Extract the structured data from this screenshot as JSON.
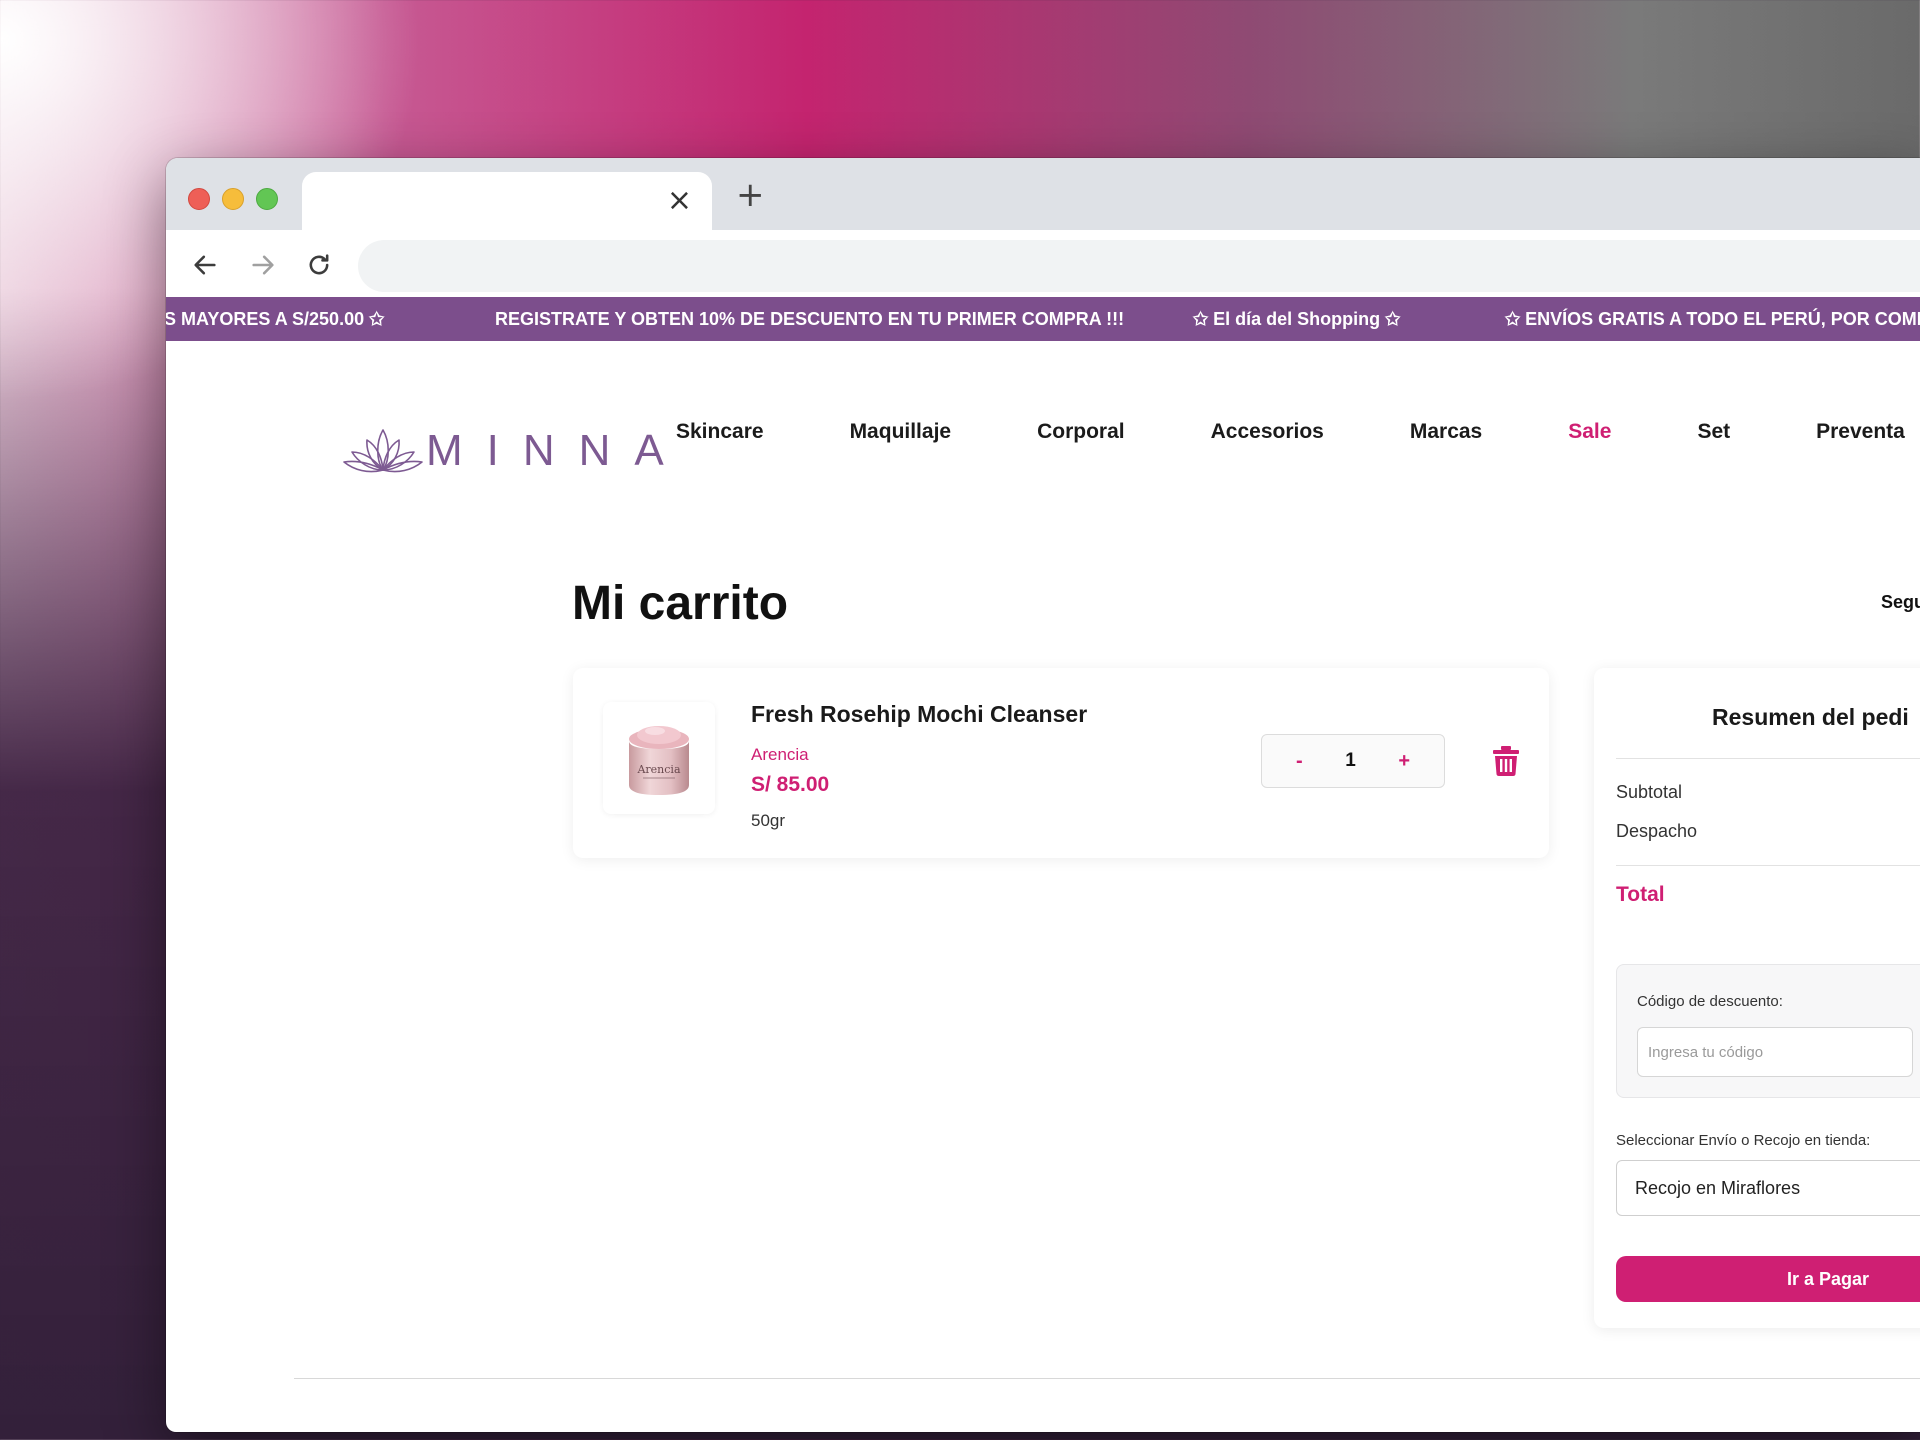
{
  "browser": {
    "tab_close": "×",
    "new_tab": "+"
  },
  "marquee": {
    "items": [
      "S MAYORES A S/250.00 ✩",
      "REGISTRATE Y OBTEN 10% DE DESCUENTO EN TU PRIMER COMPRA !!!",
      "✩ El día del Shopping ✩",
      "✩ ENVÍOS GRATIS A TODO EL PERÚ, POR COMPRA"
    ]
  },
  "header": {
    "logo_text": "MINNA",
    "nav": [
      "Skincare",
      "Maquillaje",
      "Corporal",
      "Accesorios",
      "Marcas",
      "Sale",
      "Set",
      "Preventa"
    ]
  },
  "cart": {
    "title": "Mi carrito",
    "continue_link": "Segu",
    "item": {
      "name": "Fresh Rosehip Mochi Cleanser",
      "brand": "Arencia",
      "price": "S/ 85.00",
      "size": "50gr",
      "quantity": "1",
      "minus": "-",
      "plus": "+",
      "jar_label": "Arencia"
    }
  },
  "summary": {
    "title": "Resumen del pedi",
    "subtotal_label": "Subtotal",
    "shipping_label": "Despacho",
    "total_label": "Total",
    "discount_label": "Código de descuento:",
    "discount_placeholder": "Ingresa tu código",
    "shipping_select_label": "Seleccionar Envío o Recojo en tienda:",
    "shipping_selected": "Recojo en Miraflores",
    "pay_button": "Ir a Pagar"
  },
  "colors": {
    "accent": "#cf1f73",
    "marquee_bg": "#7c4e8c",
    "logo": "#7d5a92"
  }
}
